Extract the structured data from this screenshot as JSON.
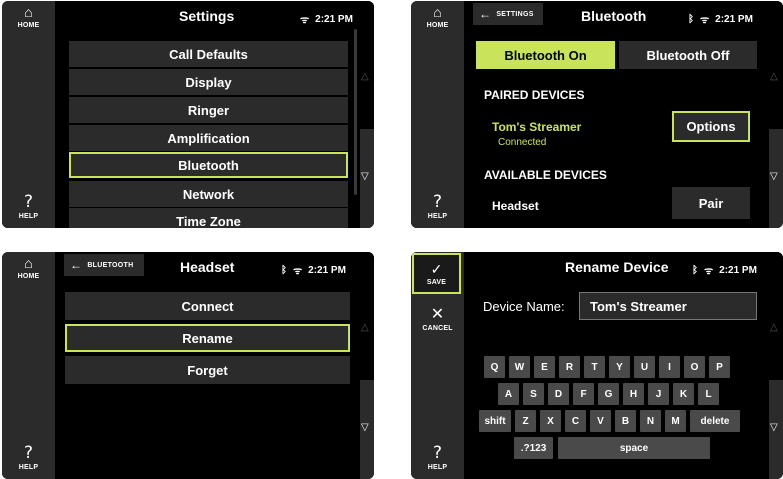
{
  "status": {
    "time": "2:21 PM",
    "wifi_icon": "wifi-icon",
    "bluetooth_icon": "bluetooth-icon"
  },
  "sidebar": {
    "home_label": "HOME",
    "help_label": "HELP",
    "help_glyph": "?",
    "save_label": "SAVE",
    "cancel_label": "CANCEL"
  },
  "colors": {
    "accent": "#c9e45a",
    "panel_bg": "#000000",
    "button_bg": "#2b2b2b",
    "key_bg": "#4a4a4a"
  },
  "settings": {
    "title": "Settings",
    "items": [
      {
        "label": "Call Defaults"
      },
      {
        "label": "Display"
      },
      {
        "label": "Ringer"
      },
      {
        "label": "Amplification"
      },
      {
        "label": "Bluetooth",
        "selected": true
      },
      {
        "label": "Network"
      },
      {
        "label": "Time Zone"
      }
    ]
  },
  "bluetooth": {
    "back_label": "SETTINGS",
    "title": "Bluetooth",
    "on_label": "Bluetooth On",
    "off_label": "Bluetooth Off",
    "paired_header": "PAIRED DEVICES",
    "paired_device_name": "Tom's Streamer",
    "paired_device_status": "Connected",
    "options_label": "Options",
    "available_header": "AVAILABLE DEVICES",
    "available_device_name": "Headset",
    "pair_label": "Pair"
  },
  "headset": {
    "back_label": "BLUETOOTH",
    "title": "Headset",
    "items": [
      {
        "label": "Connect"
      },
      {
        "label": "Rename",
        "selected": true
      },
      {
        "label": "Forget"
      }
    ]
  },
  "rename": {
    "title": "Rename Device",
    "field_label": "Device Name:",
    "field_value": "Tom's Streamer",
    "keyboard": {
      "row1": [
        "Q",
        "W",
        "E",
        "R",
        "T",
        "Y",
        "U",
        "I",
        "O",
        "P"
      ],
      "row2": [
        "A",
        "S",
        "D",
        "F",
        "G",
        "H",
        "J",
        "K",
        "L"
      ],
      "row3": [
        "shift",
        "Z",
        "X",
        "C",
        "V",
        "B",
        "N",
        "M",
        "delete"
      ],
      "row4": [
        ".?123",
        "space"
      ]
    }
  }
}
